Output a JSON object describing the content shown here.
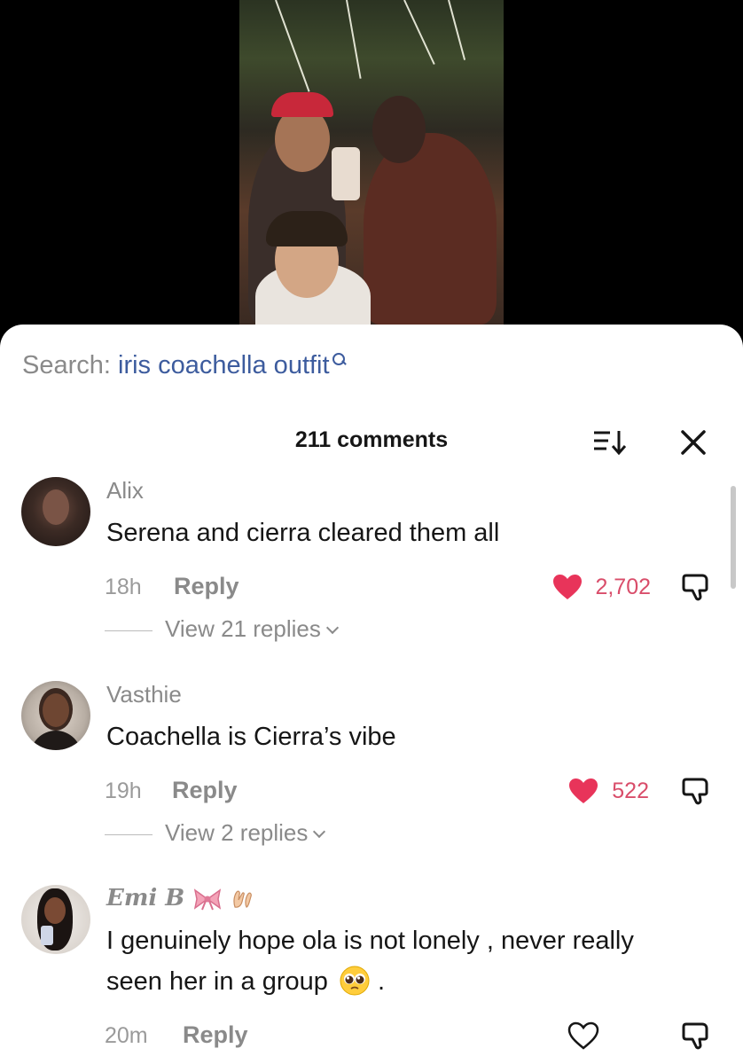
{
  "search": {
    "prefix": "Search: ",
    "query": "iris coachella outfit"
  },
  "comments_header": {
    "count_label": "211 comments"
  },
  "colors": {
    "like_red": "#e8345a",
    "search_blue": "#3d5c9e",
    "muted": "#8a8a8a"
  },
  "icons": {
    "sort": "sort-icon",
    "close": "close-icon",
    "heart": "heart-icon",
    "dislike": "dislike-icon",
    "search": "search-icon"
  },
  "comments": [
    {
      "username": "Alix",
      "text": "Serena and cierra cleared them all",
      "time": "18h",
      "reply_label": "Reply",
      "likes": "2,702",
      "liked": true,
      "view_replies": "View 21 replies"
    },
    {
      "username": "Vasthie",
      "text": "Coachella is Cierra’s vibe",
      "time": "19h",
      "reply_label": "Reply",
      "likes": "522",
      "liked": true,
      "view_replies": "View 2 replies"
    },
    {
      "username": "Emi B",
      "text_line1": "I genuinely hope ola is not lonely , never really",
      "text_line2": "seen her in a group",
      "text_suffix": ".",
      "time": "20m",
      "reply_label": "Reply",
      "liked": false
    }
  ]
}
